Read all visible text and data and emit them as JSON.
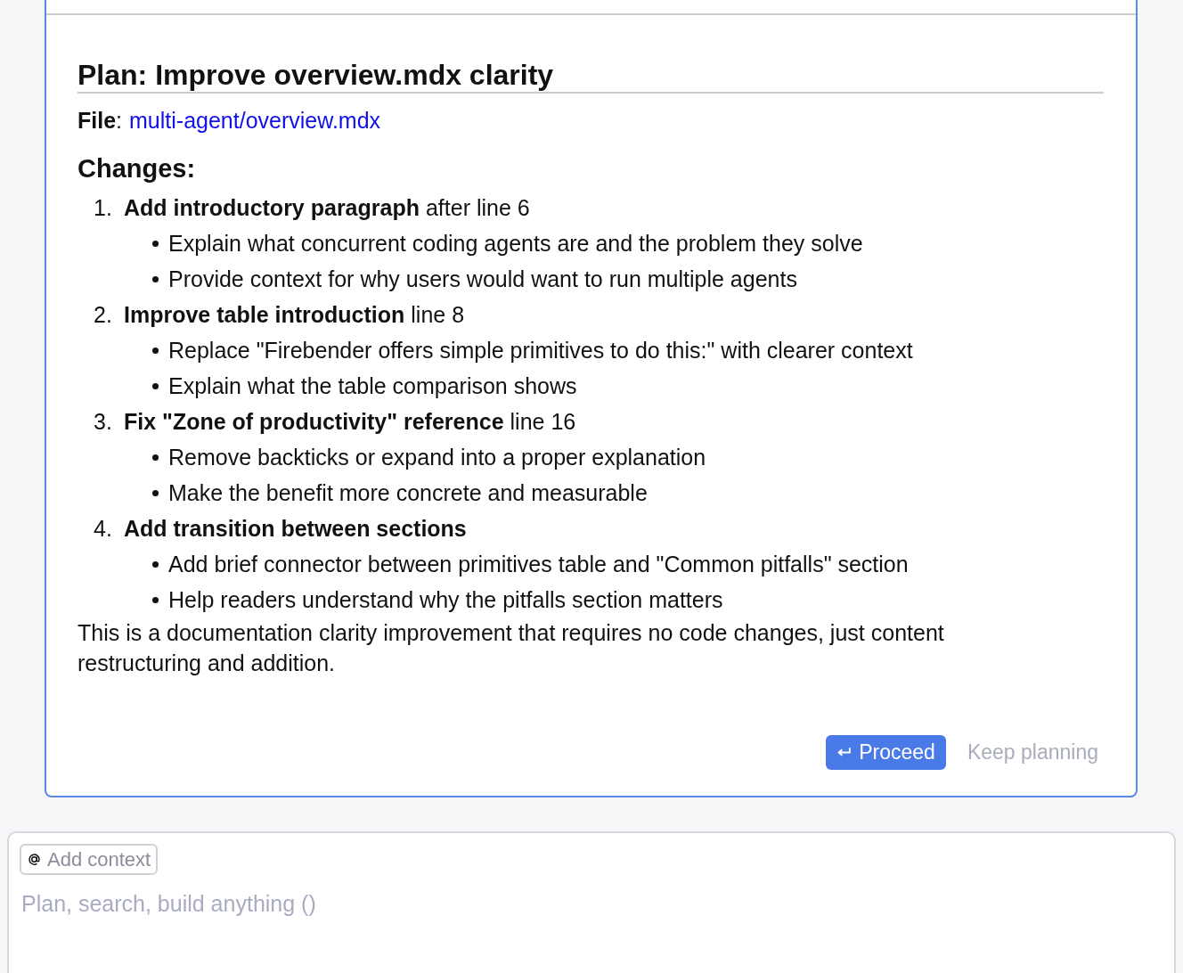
{
  "plan": {
    "title": "Plan: Improve overview.mdx clarity",
    "file_label": "**File**:",
    "file_link": "multi-agent/overview.mdx",
    "changes_heading": "Changes:",
    "steps": [
      {
        "number": "1.",
        "title": "Add introductory paragraph",
        "suffix": "after line 6",
        "bullets": [
          "Explain what concurrent coding agents are and the problem they solve",
          "Provide context for why users would want to run multiple agents"
        ]
      },
      {
        "number": "2.",
        "title": "Improve table introduction",
        "suffix": "line 8",
        "bullets": [
          "Replace \"Firebender offers simple primitives to do this:\" with clearer context",
          "Explain what the table comparison shows"
        ]
      },
      {
        "number": "3.",
        "title": "Fix \"Zone of productivity\" reference",
        "suffix": "line 16",
        "bullets": [
          "Remove backticks or expand into a proper explanation",
          "Make the benefit more concrete and measurable"
        ]
      },
      {
        "number": "4.",
        "title": "Add transition between sections",
        "bullets": [
          "Add brief connector between primitives table and \"Common pitfalls\" section",
          "Help readers understand why the pitfalls section matters"
        ]
      }
    ],
    "summary": "This is a documentation clarity improvement that requires no code changes, just content restructuring and addition.",
    "buttons": [
      {
        "kind": "primary",
        "label": "Proceed"
      },
      {
        "kind": "secondary",
        "label": "Keep planning"
      }
    ]
  },
  "composer": {
    "context_chip": "Add context",
    "placeholder": "Plan, search, build anything ()"
  }
}
